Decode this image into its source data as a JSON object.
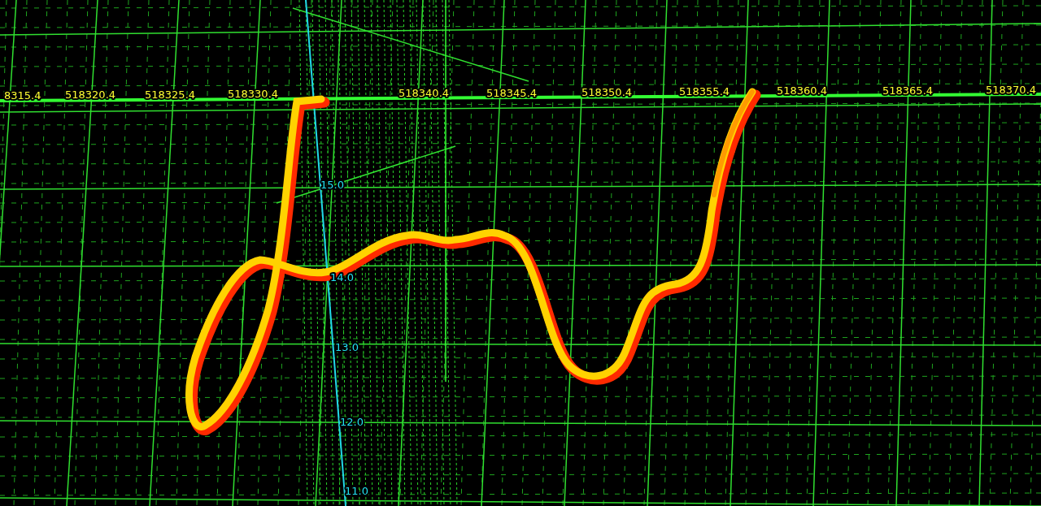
{
  "easting_labels": [
    "8315.4",
    "518320.4",
    "518325.4",
    "518330.4",
    "518340.4",
    "518345.4",
    "518350.4",
    "518355.4",
    "518360.4",
    "518365.4",
    "518370.4"
  ],
  "depth_labels": [
    "15.0",
    "14.0",
    "13.0",
    "12.0",
    "11.0"
  ]
}
